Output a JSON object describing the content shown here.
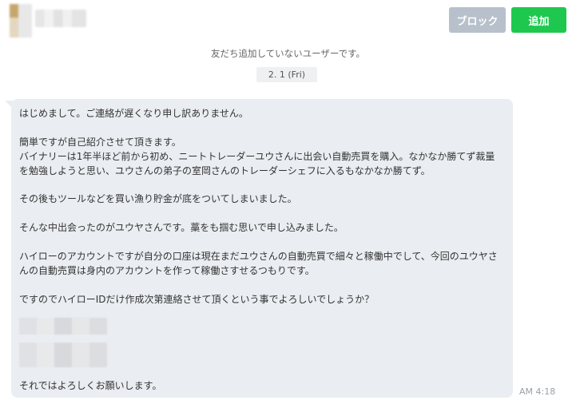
{
  "header": {
    "block_label": "ブロック",
    "add_label": "追加"
  },
  "chat": {
    "notice": "友だち追加していないユーザーです。",
    "date_badge": "2. 1 (Fri)",
    "message": {
      "lines": [
        "はじめまして。ご連絡が遅くなり申し訳ありません。",
        "簡単ですが自己紹介させて頂きます。",
        "バイナリーは1年半ほど前から初め、ニートトレーダーユウさんに出会い自動売買を購入。なかなか勝てず裁量",
        "を勉強しようと思い、ユウさんの弟子の室岡さんのトレーダーシェフに入るもなかなか勝てず。",
        "その後もツールなどを買い漁り貯金が底をついてしまいました。",
        "そんな中出会ったのがユウヤさんです。藁をも掴む思いで申し込みました。",
        "ハイローのアカウントですが自分の口座は現在まだユウさんの自動売買で細々と稼働中でして、今回のユウヤさ",
        "んの自動売買は身内のアカウントを作って稼働さすせるつもりです。",
        "ですのでハイローIDだけ作成次第連絡させて頂くという事でよろしいでしょうか？",
        "それではよろしくお願いします。"
      ],
      "time": "AM 4:18"
    }
  },
  "colors": {
    "block_button": "#b7c0cb",
    "add_button": "#1ec84e",
    "bubble": "#eaedf1"
  }
}
